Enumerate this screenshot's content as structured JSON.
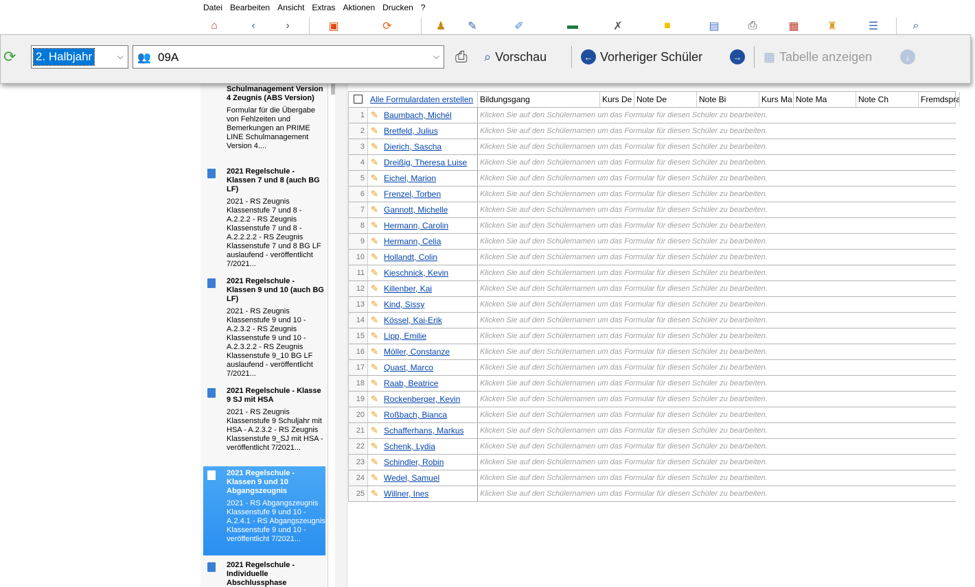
{
  "menu": [
    "Datei",
    "Bearbeiten",
    "Ansicht",
    "Extras",
    "Aktionen",
    "Drucken",
    "?"
  ],
  "toolbar_icons": [
    {
      "name": "home-icon",
      "glyph": "⌂",
      "color": "#c0392b"
    },
    {
      "name": "back-arrow-icon",
      "glyph": "‹",
      "color": "#2d6fd0"
    },
    {
      "name": "forward-arrow-icon",
      "glyph": "›",
      "color": "#555555"
    },
    {
      "name": "tv-icon",
      "glyph": "▣",
      "color": "#e04a12"
    },
    {
      "name": "sync-icon",
      "glyph": "⟳",
      "color": "#e85d1a"
    },
    {
      "name": "graduate-icon",
      "glyph": "♟",
      "color": "#c68a00"
    },
    {
      "name": "edit-document-icon",
      "glyph": "✎",
      "color": "#3a64b0"
    },
    {
      "name": "notepad-icon",
      "glyph": "✐",
      "color": "#3a8ad6"
    },
    {
      "name": "money-icon",
      "glyph": "▬",
      "color": "#1e7a3a"
    },
    {
      "name": "clipboard-delete-icon",
      "glyph": "✗",
      "color": "#555555"
    },
    {
      "name": "sticky-note-icon",
      "glyph": "■",
      "color": "#f2c200"
    },
    {
      "name": "form-icon",
      "glyph": "▤",
      "color": "#4a74c8"
    },
    {
      "name": "printer-icon",
      "glyph": "⎙",
      "color": "#444444"
    },
    {
      "name": "calendar-icon",
      "glyph": "▦",
      "color": "#c0392b"
    },
    {
      "name": "chair-icon",
      "glyph": "♜",
      "color": "#e09a20"
    },
    {
      "name": "checklist-icon",
      "glyph": "☰",
      "color": "#3a64b0"
    },
    {
      "name": "search-icon",
      "glyph": "⌕",
      "color": "#2d4f8a"
    }
  ],
  "overlay": {
    "halbjahr": "2. Halbjahr",
    "klasse": "09A",
    "preview_label": "Vorschau",
    "prev_student_label": "Vorheriger Schüler",
    "table_label": "Tabelle anzeigen"
  },
  "forms": [
    {
      "title": "Schulmanagement Version 4 Zeugnis (ABS Version)",
      "desc": "Formular für die Übergabe von Fehlzeiten und Bemerkungen an PRIME LINE Schulmanagement Version 4....",
      "selected": false,
      "icon": false
    },
    {
      "title": "2021 Regelschule - Klassen 7 und 8 (auch BG LF)",
      "desc": "2021 - RS Zeugnis Klassenstufe 7 und 8 - A.2.2.2 - RS Zeugnis Klassenstufe 7 und 8 - A.2.2.2.2 - RS Zeugnis Klassenstufe 7 und 8 BG LF auslaufend - veröffentlicht 7/2021...",
      "selected": false,
      "icon": true
    },
    {
      "title": "2021 Regelschule - Klassen 9 und 10 (auch BG LF)",
      "desc": "2021 - RS Zeugnis Klassenstufe 9 und 10 - A.2.3.2 - RS Zeugnis Klassenstufe 9 und 10 - A.2.3.2.2 - RS Zeugnis Klassenstufe 9_10 BG LF auslaufend - veröffentlicht 7/2021...",
      "selected": false,
      "icon": true
    },
    {
      "title": "2021 Regelschule - Klasse 9 SJ mit HSA",
      "desc": "2021 - RS Zeugnis Klassenstufe 9 Schuljahr mit HSA - A.2.3.2 - RS Zeugnis Klassenstufe 9_SJ mit HSA - veröffentlicht 7/2021...",
      "selected": false,
      "icon": true
    },
    {
      "title": "2021 Regelschule - Klassen 9 und 10 Abgangszeugnis",
      "desc": "2021 - RS Abgangszeugnis Klassenstufe 9 und 10 - A.2.4.1 - RS Abgangszeugnis Klassenstufe 9 und 10 - veröffentlicht 7/2021...",
      "selected": true,
      "icon": true
    },
    {
      "title": "2021 Regelschule - Individuelle Abschlussphase",
      "desc": "",
      "selected": false,
      "icon": true
    }
  ],
  "grid": {
    "all_forms_link": "Alle Formulardaten erstellen",
    "columns": [
      "Bildungsgang",
      "Kurs De",
      "Note De",
      "Note Bi",
      "Kurs Ma",
      "Note Ma",
      "Note Ch",
      "Fremdspra"
    ],
    "hint": "Klicken Sie auf den Schülernamen um das Formular für diesen Schüler zu bearbeiten.",
    "students": [
      "Baumbach, Michél",
      "Bretfeld, Julius",
      "Dierich, Sascha",
      "Dreißig, Theresa Luise",
      "Eichel, Marion",
      "Frenzel, Torben",
      "Gannott, Michelle",
      "Hermann, Carolin",
      "Hermann, Celia",
      "Hollandt, Colin",
      "Kieschnick, Kevin",
      "Killenber, Kai",
      "Kind, Sissy",
      "Kössel, Kai-Erik",
      "Lipp, Emilie",
      "Möller, Constanze",
      "Quast, Marco",
      "Raab, Beatrice",
      "Rockenberger, Kevin",
      "Roßbach, Bianca",
      "Schafferhans, Markus",
      "Schenk, Lydia",
      "Schindler, Robin",
      "Wedel, Samuel",
      "Willner, Ines"
    ]
  }
}
